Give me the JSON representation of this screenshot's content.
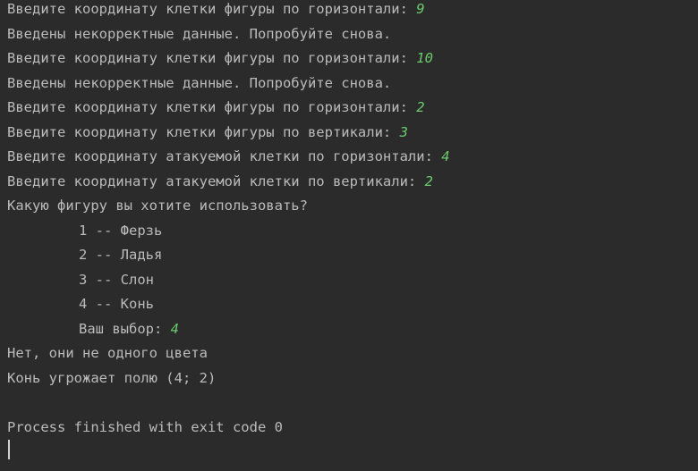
{
  "console": {
    "lines": [
      {
        "text": "Введите координату клетки фигуры по горизонтали: ",
        "input": "9"
      },
      {
        "text": "Введены некорректные данные. Попробуйте снова."
      },
      {
        "text": "Введите координату клетки фигуры по горизонтали: ",
        "input": "10"
      },
      {
        "text": "Введены некорректные данные. Попробуйте снова."
      },
      {
        "text": "Введите координату клетки фигуры по горизонтали: ",
        "input": "2"
      },
      {
        "text": "Введите координату клетки фигуры по вертикали: ",
        "input": "3"
      },
      {
        "text": "Введите координату атакуемой клетки по горизонтали: ",
        "input": "4"
      },
      {
        "text": "Введите координату атакуемой клетки по вертикали: ",
        "input": "2"
      },
      {
        "text": "Какую фигуру вы хотите использовать?"
      },
      {
        "text": "1 -- Ферзь"
      },
      {
        "text": "2 -- Ладья"
      },
      {
        "text": "3 -- Слон"
      },
      {
        "text": "4 -- Конь"
      },
      {
        "text": "Ваш выбор: ",
        "input": "4"
      },
      {
        "text": "Нет, они не одного цвета"
      },
      {
        "text": "Конь угрожает полю (4; 2)"
      },
      {
        "text": ""
      },
      {
        "text": "Process finished with exit code 0"
      }
    ]
  },
  "colors": {
    "background": "#2b2b2b",
    "text": "#bbbbbb",
    "user_input": "#6ac96a"
  }
}
